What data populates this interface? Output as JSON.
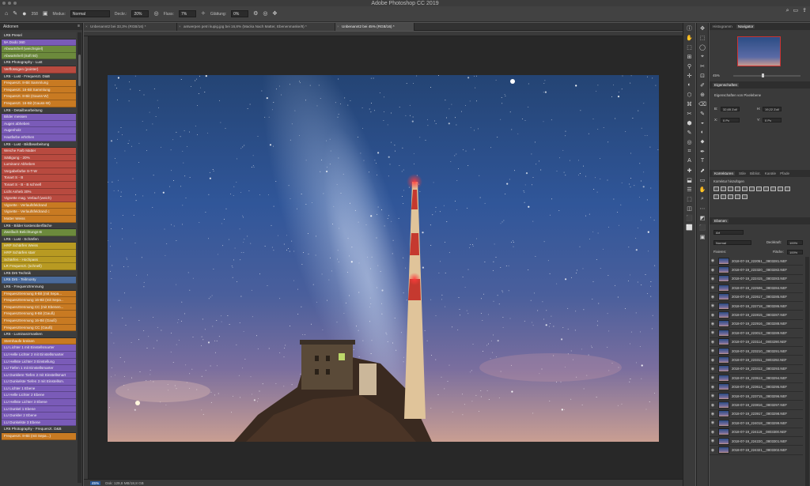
{
  "window": {
    "title": "Adobe Photoshop CC 2019"
  },
  "options": {
    "mode_label": "Modus:",
    "mode_value": "Normal",
    "opacity_label": "Deckr.:",
    "opacity_value": "20%",
    "flow_label": "Fluss:",
    "flow_value": "7%",
    "smoothing_label": "Glättung:",
    "smoothing_value": "0%",
    "brush_size": "358"
  },
  "tabs": [
    {
      "label": "Unbenannt2 bei 33,3% (RGB/16) *",
      "active": false
    },
    {
      "label": "antwerpen petri kupig.jpg bei 16,8% (Macka Nach Matter, Ebenenmaske/8) *",
      "active": false
    },
    {
      "label": "Unbenannt2 bei 45% (RGB/16) *",
      "active": true
    }
  ],
  "actions_panel": {
    "title": "Aktionen",
    "items": [
      {
        "label": "LR6 Presel",
        "color": "#3d3d3d"
      },
      {
        "label": "9A Dodo 360",
        "color": "#7a5bb8"
      },
      {
        "label": "Abwartshell (weichspiel)",
        "color": "#6c8a3c"
      },
      {
        "label": "Abwartshell (Soft 50)",
        "color": "#6c8a3c"
      },
      {
        "label": "LR6 Photography - Lust",
        "color": "#3d3d3d"
      },
      {
        "label": "Verflüssigen (pointer)",
        "color": "#b84a3f"
      },
      {
        "label": "LR6 - Lust - Frequenzt. D&B",
        "color": "#3d3d3d"
      },
      {
        "label": "Frequenzt. 8-Bit Sammlung",
        "color": "#c87a22"
      },
      {
        "label": "Frequenzt. 16-Bit Sammlung",
        "color": "#c87a22"
      },
      {
        "label": "Frequenzt. 8-Bit (Gauss-W)",
        "color": "#c87a22"
      },
      {
        "label": "Frequenzt. 16-Bit (Gauss-W)",
        "color": "#c87a22"
      },
      {
        "label": "LR6 - Detailbearbeitung",
        "color": "#3d3d3d"
      },
      {
        "label": "Bilder messen",
        "color": "#7a5bb8"
      },
      {
        "label": "Augen abheben",
        "color": "#7a5bb8"
      },
      {
        "label": "Augenholz",
        "color": "#7a5bb8"
      },
      {
        "label": "Hautfarbe erhöhen",
        "color": "#7a5bb8"
      },
      {
        "label": "LR6 - Lust - Bildbearbeitung",
        "color": "#3d3d3d"
      },
      {
        "label": "Weiche Farb Matter",
        "color": "#b84a3f"
      },
      {
        "label": "Sättigung - 20%",
        "color": "#b84a3f"
      },
      {
        "label": "Luminanz Abheben",
        "color": "#b84a3f"
      },
      {
        "label": "Vorgabefarbe S-T-W",
        "color": "#b84a3f"
      },
      {
        "label": "Tonart S - B",
        "color": "#b84a3f"
      },
      {
        "label": "Tonart S - B - B schnell",
        "color": "#b84a3f"
      },
      {
        "label": "Licht Anheb 30%",
        "color": "#b84a3f"
      },
      {
        "label": "Vignette mag. Verlauf (weich)",
        "color": "#b84a3f"
      },
      {
        "label": "Vignette - Verlaufsfeldrand",
        "color": "#c87a22"
      },
      {
        "label": "Vignette - Verlaufsfeldrand c",
        "color": "#c87a22"
      },
      {
        "label": "Matter Weiss",
        "color": "#c87a22"
      },
      {
        "label": "LR6 - Bilder kostenoberfläche",
        "color": "#3d3d3d"
      },
      {
        "label": "Zweifach Belichtungs-B",
        "color": "#6c8a3c"
      },
      {
        "label": "LR6 - Lust - Schärfen",
        "color": "#3d3d3d"
      },
      {
        "label": "HRP Schärfen Weiss",
        "color": "#b89a22"
      },
      {
        "label": "HRP Schärfen starr",
        "color": "#b89a22"
      },
      {
        "label": "Schärfen - Hochpass",
        "color": "#b89a22"
      },
      {
        "label": "LR Frequenzt. (schnell)",
        "color": "#b89a22"
      },
      {
        "label": "LR6 Dr6 Technik",
        "color": "#3d3d3d"
      },
      {
        "label": "LR6 Dr6 - Teilmonty",
        "color": "#4a6a9a"
      },
      {
        "label": "LR6 - Frequenztrennung",
        "color": "#3d3d3d"
      },
      {
        "label": "Frequenztrennung 8-Bit (mit Sepa...",
        "color": "#c87a22"
      },
      {
        "label": "Frequenztrennung 16-Bit (mit Sepa...",
        "color": "#c87a22"
      },
      {
        "label": "Frequenztrennung CC (mit Ebenen...",
        "color": "#c87a22"
      },
      {
        "label": "Frequenztrennung 8-Bit (Gauß)",
        "color": "#c87a22"
      },
      {
        "label": "Frequenztrennung 16-Bit (Gauß)",
        "color": "#c87a22"
      },
      {
        "label": "Frequenztrennung CC (Gauß)",
        "color": "#c87a22"
      },
      {
        "label": "LR6 - Luminanzmasken",
        "color": "#3d3d3d"
      },
      {
        "label": "Sternhaufe kreisen",
        "color": "#c87a22"
      },
      {
        "label": "LU Lichter 1 mit Einstellsmarter",
        "color": "#7a5bb8"
      },
      {
        "label": "LU Helle Lichter 2 mit Einstellsmarter",
        "color": "#7a5bb8"
      },
      {
        "label": "LU Hellste Lichter 3 Einstellung",
        "color": "#7a5bb8"
      },
      {
        "label": "LU Tiefen 1 mit Einstellsmarter",
        "color": "#7a5bb8"
      },
      {
        "label": "LU Dunklere Tiefen 2 mit Einstellsmart",
        "color": "#7a5bb8"
      },
      {
        "label": "LU Dunkelste Tiefen 3 mit Einstellsm.",
        "color": "#7a5bb8"
      },
      {
        "label": "LU Lichter 1 Ebene",
        "color": "#7a5bb8"
      },
      {
        "label": "LU Helle Lichter 2 Ebene",
        "color": "#7a5bb8"
      },
      {
        "label": "LU Hellste Lichter 3 Ebene",
        "color": "#7a5bb8"
      },
      {
        "label": "LU Dunkel 1 Ebene",
        "color": "#7a5bb8"
      },
      {
        "label": "LU Dunkler 2 Ebene",
        "color": "#7a5bb8"
      },
      {
        "label": "LU Dunkelste 3 Ebene",
        "color": "#7a5bb8"
      },
      {
        "label": "LR6 Photography - Frequenzt. D&B",
        "color": "#3d3d3d"
      },
      {
        "label": "Frequenzt. 8-Bit (mit Sepa...)",
        "color": "#c87a22"
      }
    ]
  },
  "status": {
    "zoom": "45%",
    "doc": "Dok: 129,8 MB/18,8 GB"
  },
  "navigator": {
    "tab1": "Histogramm",
    "tab2": "Navigator",
    "zoom": "45%"
  },
  "properties": {
    "title": "Eigenschaften",
    "subtitle": "Eigenschaften von Pixelebene",
    "w_label": "B:",
    "w_value": "32,65 Zoll",
    "h_label": "H:",
    "h_value": "19,22 Zoll",
    "x_label": "X:",
    "x_value": "0 Px",
    "y_label": "Y:",
    "y_value": "0 Px"
  },
  "adjustments": {
    "tabs": [
      "Korrekturen",
      "Stile",
      "Bibliot.",
      "Kanäle",
      "Pfade"
    ],
    "add_label": "Korrektur hinzufügen"
  },
  "layers": {
    "title": "Ebenen",
    "filter_value": "Art",
    "blend_value": "Normal",
    "opacity_label": "Deckkraft:",
    "opacity_value": "100%",
    "lock_label": "Fixieren:",
    "fill_label": "Fläche:",
    "fill_value": "100%",
    "rows": [
      "2018-07-19_222051__0803281.NEF",
      "2018-07-19_222320__0803282.NEF",
      "2018-07-19_222415__0803283.NEF",
      "2018-07-19_222506__0803284.NEF",
      "2018-07-19_222617__0803285.NEF",
      "2018-07-19_222718__0803286.NEF",
      "2018-07-19_222815__0803287.NEF",
      "2018-07-19_222916__0803288.NEF",
      "2018-07-19_223013__0803289.NEF",
      "2018-07-19_223114__0803290.NEF",
      "2018-07-19_223210__0803291.NEF",
      "2018-07-19_223311__0803292.NEF",
      "2018-07-19_223412__0803293.NEF",
      "2018-07-19_223513__0803294.NEF",
      "2018-07-19_223614__0803295.NEF",
      "2018-07-19_223715__0803296.NEF",
      "2018-07-19_223816__0803297.NEF",
      "2018-07-19_223917__0803298.NEF",
      "2018-07-19_224018__0803299.NEF",
      "2018-07-19_224119__0803300.NEF",
      "2018-07-19_224220__0803301.NEF",
      "2018-07-19_224321__0803302.NEF"
    ]
  }
}
